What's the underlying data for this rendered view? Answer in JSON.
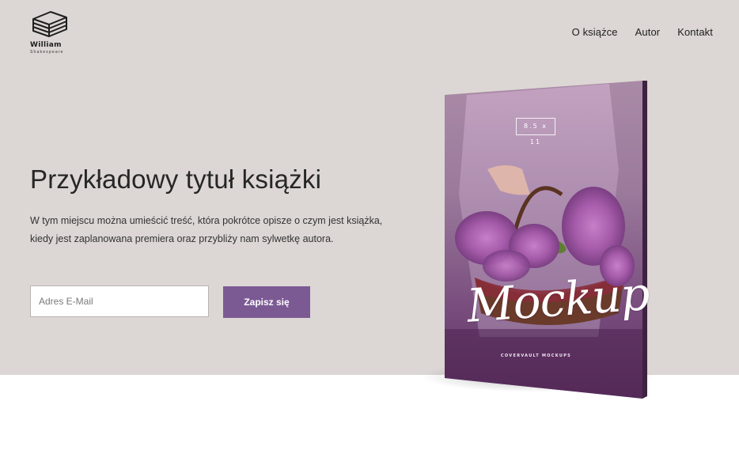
{
  "logo": {
    "name": "William",
    "subtitle": "Shakespeare",
    "icon": "books-stack-icon"
  },
  "nav": {
    "items": [
      {
        "label": "O książce"
      },
      {
        "label": "Autor"
      },
      {
        "label": "Kontakt"
      }
    ]
  },
  "hero": {
    "title": "Przykładowy tytuł książki",
    "description_line1": "W tym miejscu można umieścić treść, która pokrótce opisze o czym jest książka,",
    "description_line2": "kiedy jest zaplanowana premiera oraz przybliży nam sylwetkę autora."
  },
  "signup": {
    "email_placeholder": "Adres E-Mail",
    "email_value": "",
    "submit_label": "Zapisz się"
  },
  "book": {
    "size_label": "8.5 x 11",
    "mockup_text": "Mockup",
    "brand": "COVERVAULT MOCKUPS"
  },
  "colors": {
    "hero_background": "#dcd6d4",
    "accent": "#7b5a94",
    "page_background": "#ffffff"
  }
}
